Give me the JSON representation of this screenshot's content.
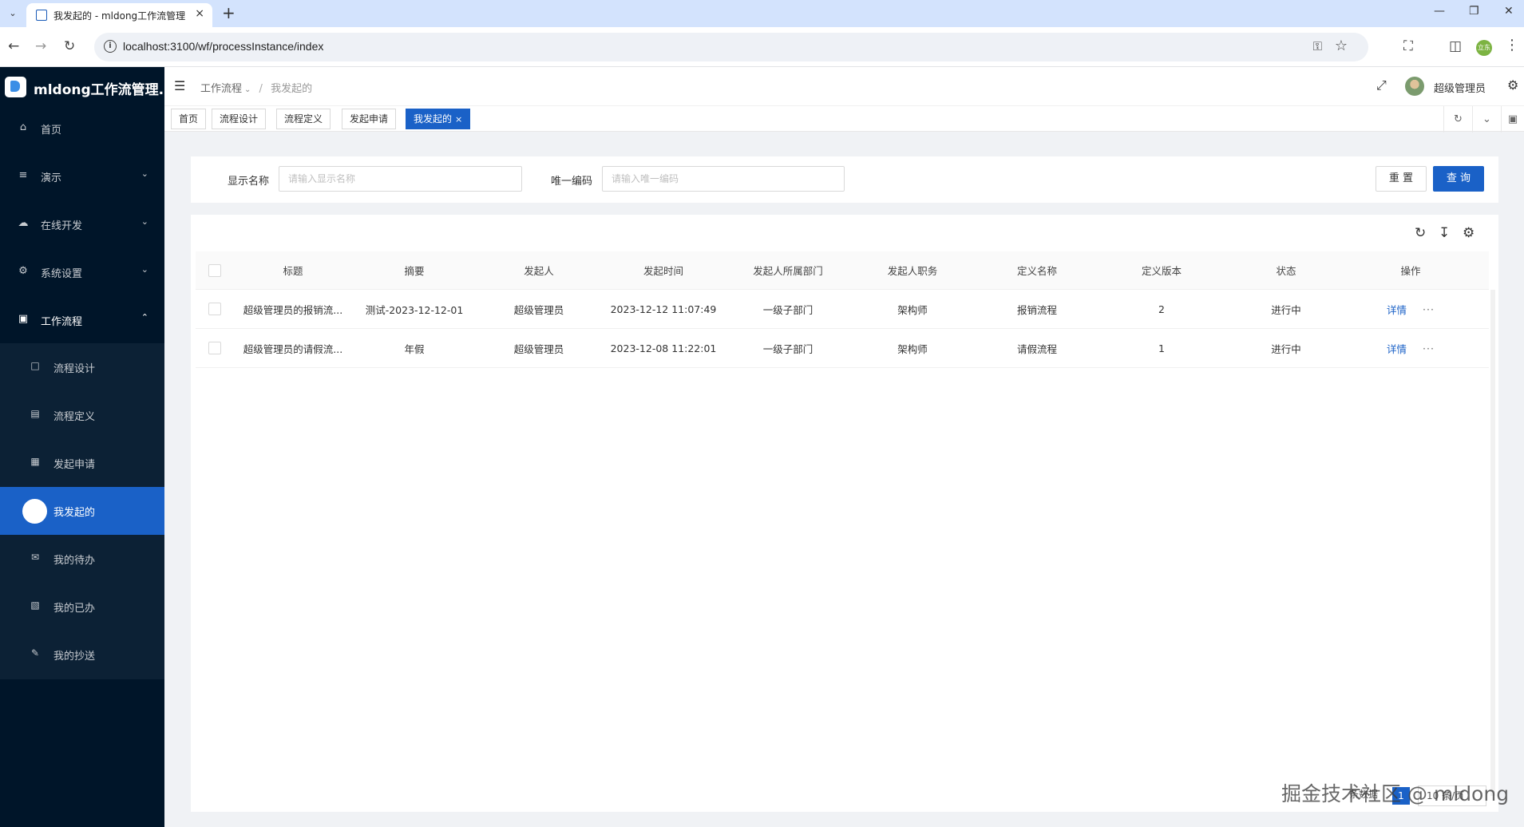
{
  "browser": {
    "tab_title": "我发起的 - mldong工作流管理",
    "url": "localhost:3100/wf/processInstance/index",
    "profile_label": "立东"
  },
  "app": {
    "title": "mldong工作流管理..."
  },
  "sidebar": {
    "items": [
      {
        "label": "首页",
        "icon": "home-icon"
      },
      {
        "label": "演示",
        "icon": "list-icon"
      },
      {
        "label": "在线开发",
        "icon": "cloud-icon"
      },
      {
        "label": "系统设置",
        "icon": "gear-icon"
      },
      {
        "label": "工作流程",
        "icon": "monitor-icon"
      }
    ],
    "sub_items": [
      {
        "label": "流程设计",
        "icon": "file-icon"
      },
      {
        "label": "流程定义",
        "icon": "image-icon"
      },
      {
        "label": "发起申请",
        "icon": "grid-icon"
      },
      {
        "label": "我发起的",
        "icon": "circle-icon"
      },
      {
        "label": "我的待办",
        "icon": "mail-icon"
      },
      {
        "label": "我的已办",
        "icon": "book-icon"
      },
      {
        "label": "我的抄送",
        "icon": "edit-icon"
      }
    ]
  },
  "header": {
    "breadcrumb": [
      "工作流程",
      "我发起的"
    ],
    "user_name": "超级管理员"
  },
  "page_tabs": [
    "首页",
    "流程设计",
    "流程定义",
    "发起申请",
    "我发起的"
  ],
  "search": {
    "name_label": "显示名称",
    "name_placeholder": "请输入显示名称",
    "code_label": "唯一编码",
    "code_placeholder": "请输入唯一编码",
    "reset_label": "重 置",
    "query_label": "查 询"
  },
  "table": {
    "columns": [
      "标题",
      "摘要",
      "发起人",
      "发起时间",
      "发起人所属部门",
      "发起人职务",
      "定义名称",
      "定义版本",
      "状态",
      "操作"
    ],
    "rows": [
      {
        "title": "超级管理员的报销流...",
        "summary": "测试-2023-12-12-01",
        "initiator": "超级管理员",
        "time": "2023-12-12 11:07:49",
        "dept": "一级子部门",
        "post": "架构师",
        "def_name": "报销流程",
        "version": "2",
        "status": "进行中",
        "action": "详情",
        "more": "···"
      },
      {
        "title": "超级管理员的请假流...",
        "summary": "年假",
        "initiator": "超级管理员",
        "time": "2023-12-08 11:22:01",
        "dept": "一级子部门",
        "post": "架构师",
        "def_name": "请假流程",
        "version": "1",
        "status": "进行中",
        "action": "详情",
        "more": "···"
      }
    ]
  },
  "pagination": {
    "total_text": "条数据",
    "current_page": "1",
    "page_size": "10 条/页"
  },
  "watermark": "掘金技术社区 @ mldong",
  "colors": {
    "primary": "#1a61c7",
    "sidebar_bg": "#001529",
    "submenu_bg": "#0c2135"
  }
}
